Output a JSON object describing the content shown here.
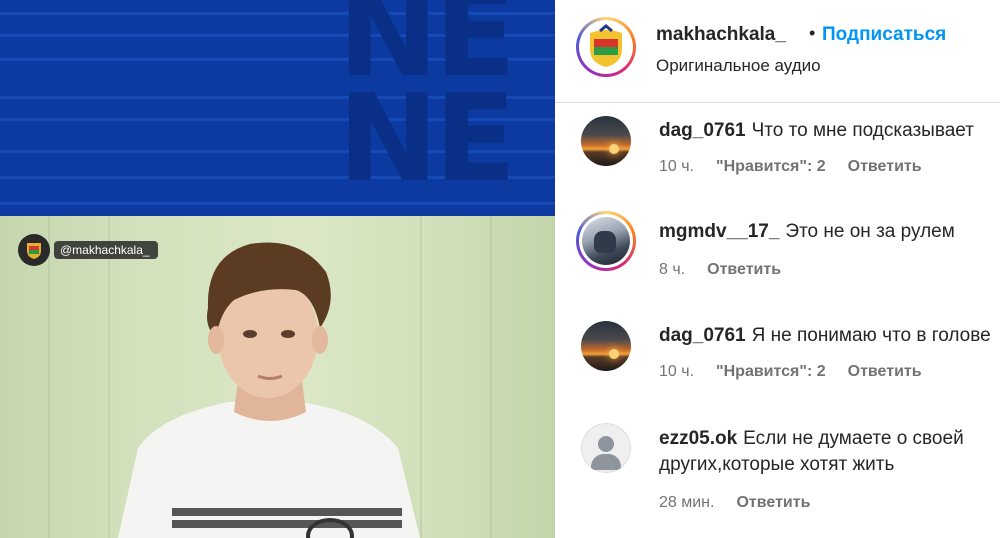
{
  "media": {
    "watermark_handle": "@makhachkala_",
    "background_letters": [
      "NE",
      "NE"
    ]
  },
  "header": {
    "username": "makhachkala_",
    "separator": "•",
    "follow_label": "Подписаться",
    "audio_label": "Оригинальное аудио"
  },
  "comments": [
    {
      "username": "dag_0761",
      "text": "Что то мне подсказывает",
      "time": "10 ч.",
      "likes": "\"Нравится\": 2",
      "reply": "Ответить",
      "avatar": "sunset-avatar"
    },
    {
      "username": "mgmdv__17_",
      "text": "Это не он за рулем",
      "time": "8 ч.",
      "likes": "",
      "reply": "Ответить",
      "avatar": "car-avatar"
    },
    {
      "username": "dag_0761",
      "text": "Я не понимаю что в голове",
      "time": "10 ч.",
      "likes": "\"Нравится\": 2",
      "reply": "Ответить",
      "avatar": "sunset-avatar"
    },
    {
      "username": "ezz05.ok",
      "text": "Если не думаете о своей",
      "text_line2": "других,которые хотят жить",
      "time": "28 мин.",
      "likes": "",
      "reply": "Ответить",
      "avatar": "default-avatar"
    }
  ],
  "colors": {
    "follow_blue": "#0095f6",
    "secondary_text": "#737373",
    "media_blue": "#0d3aa0",
    "media_wall": "#d3e1bd"
  }
}
